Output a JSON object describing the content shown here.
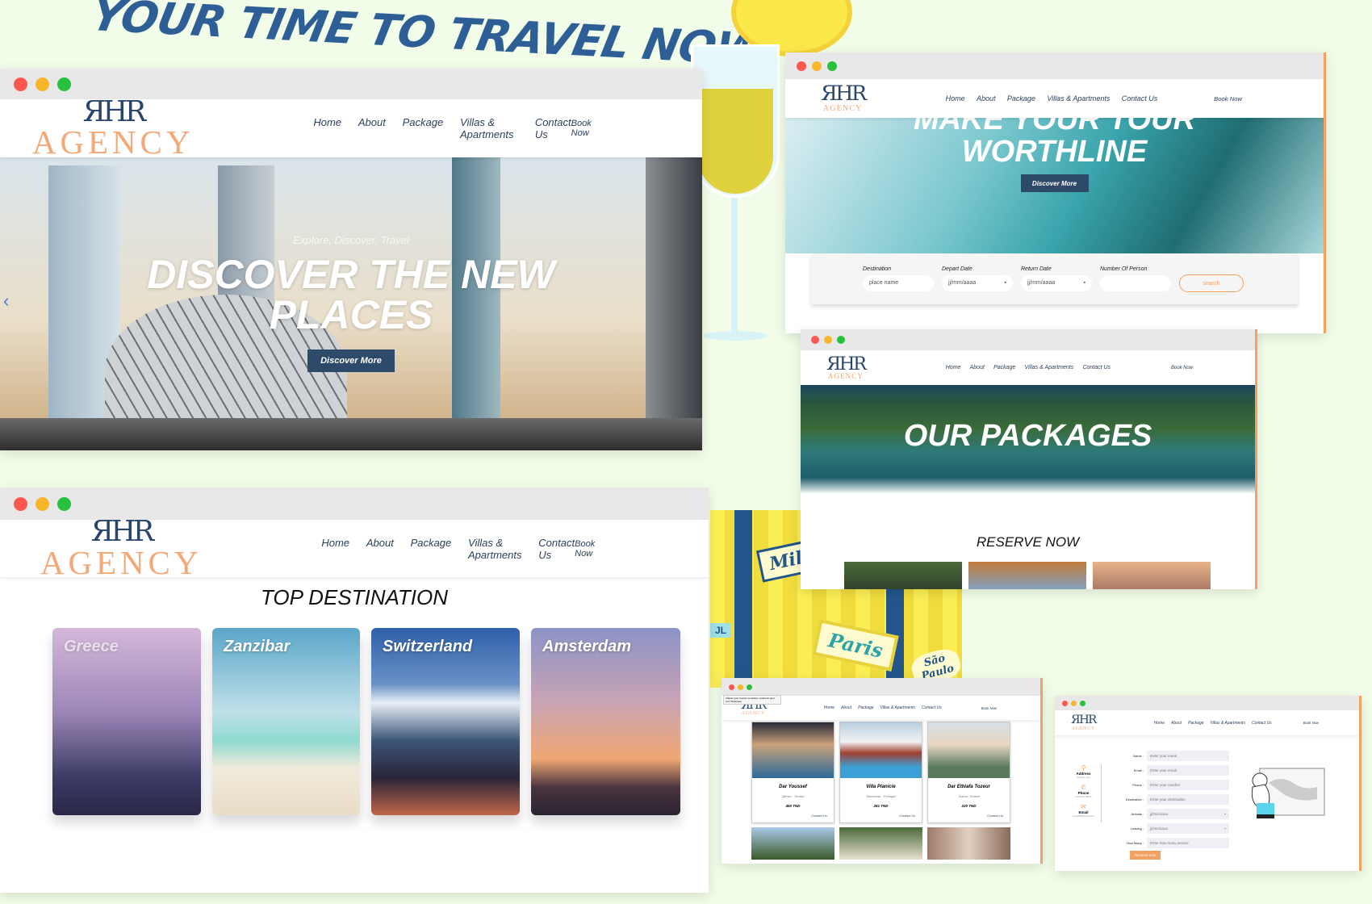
{
  "headline": "YOUR TIME TO TRAVEL NOW",
  "brand": {
    "mark": "ЯHR",
    "name": "AGENCY"
  },
  "nav": {
    "items": [
      "Home",
      "About",
      "Package",
      "Villas & Apartments",
      "Contact Us"
    ],
    "book": "Book Now"
  },
  "home": {
    "kicker": "Explore, Discover, Travel",
    "title": "DISCOVER THE NEW PLACES",
    "cta": "Discover More",
    "prev": "‹",
    "next": "›"
  },
  "destinations": {
    "title": "TOP DESTINATION",
    "cards": [
      "Greece",
      "Zanzibar",
      "Switzerland",
      "Amsterdam"
    ]
  },
  "search": {
    "title": "MAKE YOUR TOUR WORTHLINE",
    "cta": "Discover More",
    "fields": [
      {
        "label": "Destination",
        "placeholder": "place name"
      },
      {
        "label": "Depart Date",
        "value": "jj/mm/aaaa"
      },
      {
        "label": "Return Date",
        "value": "jj/mm/aaaa"
      },
      {
        "label": "Number Of Person",
        "value": ""
      }
    ],
    "button": "search"
  },
  "packages": {
    "title": "OUR PACKAGES",
    "reserve": "RESERVE NOW"
  },
  "stickers": [
    "Milan",
    "Paris",
    "São Paulo",
    "JL"
  ],
  "villas": {
    "tooltip": "Cliquer pour revenir en arrière, maintenir pour voir l'historique",
    "cards": [
      {
        "name": "Dar Youssef",
        "loc": "Djerba - Tunisie",
        "price": "460 TND",
        "link": "Contact Us"
      },
      {
        "name": "Villa Planicie",
        "loc": "Monsaraz - Portugal",
        "price": "281 TND",
        "link": "Contact Us"
      },
      {
        "name": "Dar Ethiafa Tozeur",
        "loc": "Tozeur, Tunisie",
        "price": "220 TND",
        "link": "Contact Us"
      }
    ]
  },
  "reserve": {
    "contacts": [
      {
        "label": "Address",
        "value": "Tunisia, Loot",
        "icon": "pin-icon"
      },
      {
        "label": "Phone",
        "value": "+21650178622",
        "icon": "phone-icon"
      },
      {
        "label": "Email",
        "value": "Yusoff05@Outlook.fr",
        "icon": "mail-icon"
      }
    ],
    "fields": [
      {
        "label": "Name :",
        "placeholder": "Enter your name"
      },
      {
        "label": "Email :",
        "placeholder": "Enter your email"
      },
      {
        "label": "Phone :",
        "placeholder": "Enter your number"
      },
      {
        "label": "Destination :",
        "placeholder": "Enter your destination"
      },
      {
        "label": "Arrivals :",
        "placeholder": "jj/mm/aaaa",
        "date": true
      },
      {
        "label": "Leaving :",
        "placeholder": "jj/mm/aaaa",
        "date": true
      },
      {
        "label": "How Many :",
        "placeholder": "Enter how many person"
      }
    ],
    "button": "Reserve now"
  },
  "colors": {
    "accent": "#f3a060",
    "navy": "#2e4a6a",
    "title": "#2d5f96"
  }
}
